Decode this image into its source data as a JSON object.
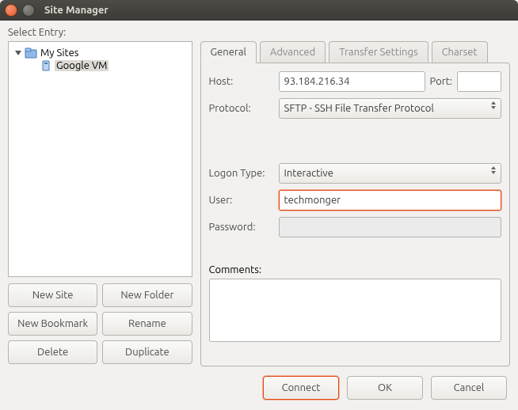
{
  "window": {
    "title": "Site Manager"
  },
  "left": {
    "label": "Select Entry:",
    "root": "My Sites",
    "site": "Google VM",
    "buttons": {
      "new_site": "New Site",
      "new_folder": "New Folder",
      "new_bookmark": "New Bookmark",
      "rename": "Rename",
      "delete": "Delete",
      "duplicate": "Duplicate"
    }
  },
  "tabs": {
    "general": "General",
    "advanced": "Advanced",
    "transfer": "Transfer Settings",
    "charset": "Charset"
  },
  "form": {
    "host_label": "Host:",
    "host_value": "93.184.216.34",
    "port_label": "Port:",
    "port_value": "",
    "protocol_label": "Protocol:",
    "protocol_value": "SFTP - SSH File Transfer Protocol",
    "logon_label": "Logon Type:",
    "logon_value": "Interactive",
    "user_label": "User:",
    "user_value": "techmonger",
    "password_label": "Password:",
    "password_value": "",
    "comments_label": "Comments:",
    "comments_value": ""
  },
  "footer": {
    "connect": "Connect",
    "ok": "OK",
    "cancel": "Cancel"
  }
}
